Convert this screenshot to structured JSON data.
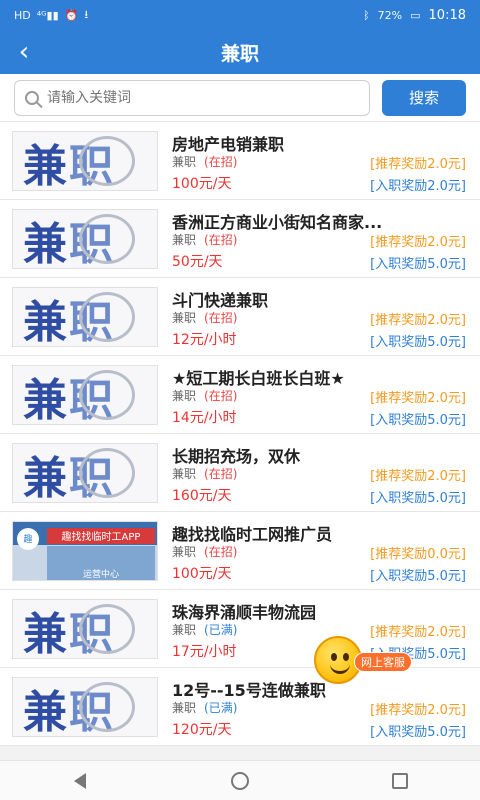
{
  "status": {
    "left_icons": [
      "HD",
      "4G",
      "signal",
      "alarm",
      "download"
    ],
    "battery": "72%",
    "time": "10:18"
  },
  "header": {
    "title": "兼职",
    "back_icon": "chevron-left-icon"
  },
  "search": {
    "placeholder": "请输入关键词",
    "button": "搜索"
  },
  "jobs": [
    {
      "title": "房地产电销兼职",
      "type": "兼职",
      "status": "(在招)",
      "wage": "100元/天",
      "recommend": "[推荐奖励2.0元]",
      "onboard": "[入职奖励2.0元]",
      "thumb": "logo"
    },
    {
      "title": "香洲正方商业小街知名商家...",
      "type": "兼职",
      "status": "(在招)",
      "wage": "50元/天",
      "recommend": "[推荐奖励2.0元]",
      "onboard": "[入职奖励5.0元]",
      "thumb": "logo"
    },
    {
      "title": "斗门快递兼职",
      "type": "兼职",
      "status": "(在招)",
      "wage": "12元/小时",
      "recommend": "[推荐奖励2.0元]",
      "onboard": "[入职奖励5.0元]",
      "thumb": "logo"
    },
    {
      "title": "★短工期长白班长白班★",
      "type": "兼职",
      "status": "(在招)",
      "wage": "14元/小时",
      "recommend": "[推荐奖励2.0元]",
      "onboard": "[入职奖励5.0元]",
      "thumb": "logo"
    },
    {
      "title": "长期招充场，双休",
      "type": "兼职",
      "status": "(在招)",
      "wage": "160元/天",
      "recommend": "[推荐奖励2.0元]",
      "onboard": "[入职奖励5.0元]",
      "thumb": "logo"
    },
    {
      "title": "趣找找临时工网推广员",
      "type": "兼职",
      "status": "(在招)",
      "wage": "100元/天",
      "recommend": "[推荐奖励0.0元]",
      "onboard": "[入职奖励5.0元]",
      "thumb": "photo",
      "photo_sign": "趣找找临时工APP",
      "photo_sub": "运营中心"
    },
    {
      "title": "珠海界涌顺丰物流园",
      "type": "兼职",
      "status": "(已满)",
      "wage": "17元/小时",
      "recommend": "[推荐奖励2.0元]",
      "onboard": "[入职奖励5.0元]",
      "thumb": "logo"
    },
    {
      "title": "12号--15号连做兼职",
      "type": "兼职",
      "status": "(已满)",
      "wage": "120元/天",
      "recommend": "[推荐奖励2.0元]",
      "onboard": "[入职奖励5.0元]",
      "thumb": "logo"
    }
  ],
  "logo_text": {
    "a": "兼",
    "b": "职"
  },
  "float_cs": {
    "label": "网上客服"
  },
  "colors": {
    "primary": "#2f7fd6",
    "accent": "#f29b21",
    "red": "#e33"
  }
}
